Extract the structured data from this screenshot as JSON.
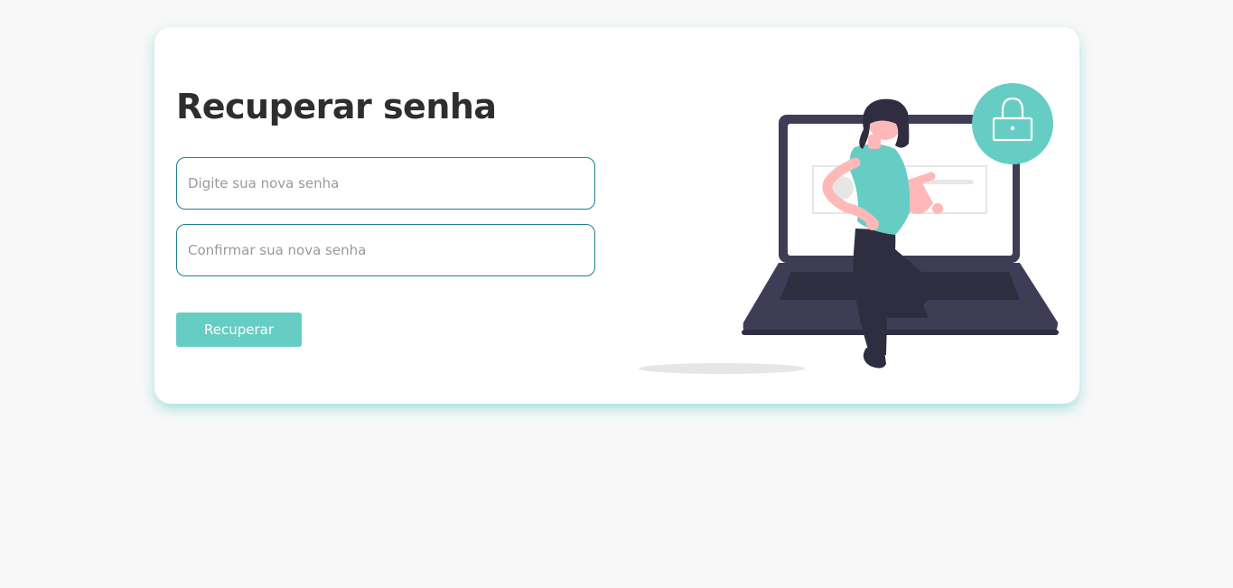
{
  "form": {
    "title": "Recuperar senha",
    "new_password_placeholder": "Digite sua nova senha",
    "confirm_password_placeholder": "Confirmar sua nova senha",
    "submit_label": "Recuperar"
  },
  "colors": {
    "accent": "#66cdc4",
    "input_border": "#1c7f8c",
    "laptop": "#3f3d56",
    "text_dark": "#2e2e2e",
    "background": "#f8f8f8"
  },
  "illustration": {
    "icon": "lock-icon",
    "subject": "woman-with-laptop"
  }
}
